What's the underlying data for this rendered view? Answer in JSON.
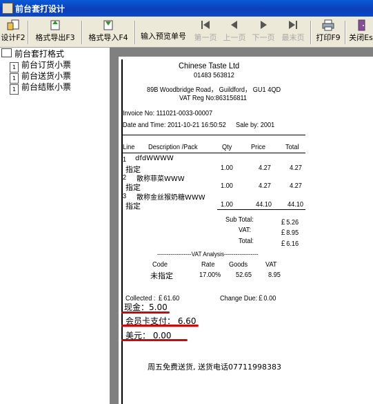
{
  "window": {
    "title": "前台套打设计"
  },
  "toolbar": {
    "design": "设计F2",
    "export": "格式导出F3",
    "import": "格式导入F4",
    "input_preview": "输入预览单号",
    "first_page": "第一页",
    "prev_page": "上一页",
    "next_page": "下一页",
    "last_page": "最末页",
    "print": "打印F9",
    "close": "关闭Es"
  },
  "tree": {
    "root": "前台套打格式",
    "items": [
      "前台订货小票",
      "前台送货小票",
      "前台结账小票"
    ]
  },
  "receipt": {
    "company": "Chinese Taste Ltd",
    "phone": "01483 563812",
    "address": "89B Woodbridge Road， Guildford， GU1 4QD",
    "vat_reg": "VAT Reg No:863156811",
    "invoice_no": "Invoice No: 111021-0033-00007",
    "date_time": "Date and Time: 2011-10-21 16:50:52",
    "sale_by": "Sale by:  2001",
    "columns": {
      "line": "Line",
      "desc": "Description /Pack",
      "qty": "Qty",
      "price": "Price",
      "total": "Total"
    },
    "items": [
      {
        "line": "1",
        "desc": "dfdWWWW",
        "pack": "指定",
        "qty": "1.00",
        "price": "4.27",
        "total": "4.27"
      },
      {
        "line": "2",
        "desc": "散称菲菜WWW",
        "pack": "指定",
        "qty": "1.00",
        "price": "4.27",
        "total": "4.27"
      },
      {
        "line": "3",
        "desc": "散称金丝猴奶糖WWW",
        "pack": "指定",
        "qty": "1.00",
        "price": "44.10",
        "total": "44.10"
      }
    ],
    "totals": {
      "subtotal_label": "Sub Total:",
      "subtotal": "￡5.26",
      "vat_label": "VAT:",
      "vat": "￡8.95",
      "total_label": "Total:",
      "total": "￡6.16"
    },
    "vat_analysis": {
      "title": "------------------VAT Analysis------------------",
      "headers": [
        "Code",
        "Rate",
        "Goods",
        "VAT"
      ],
      "row": [
        "未指定",
        "17.00%",
        "52.65",
        "8.95"
      ]
    },
    "collected": "Collected : ￡61.60",
    "change_due": "Change Due:￡0.00",
    "cash": "现金：5.00",
    "member_card": "会员卡支付： 6.60",
    "usd": "美元：    0.00",
    "footer": "周五免费送货, 送货电话07711998383"
  },
  "colors": {
    "title_bar": "#0b3fb8",
    "highlight_underline": "#e00000"
  }
}
